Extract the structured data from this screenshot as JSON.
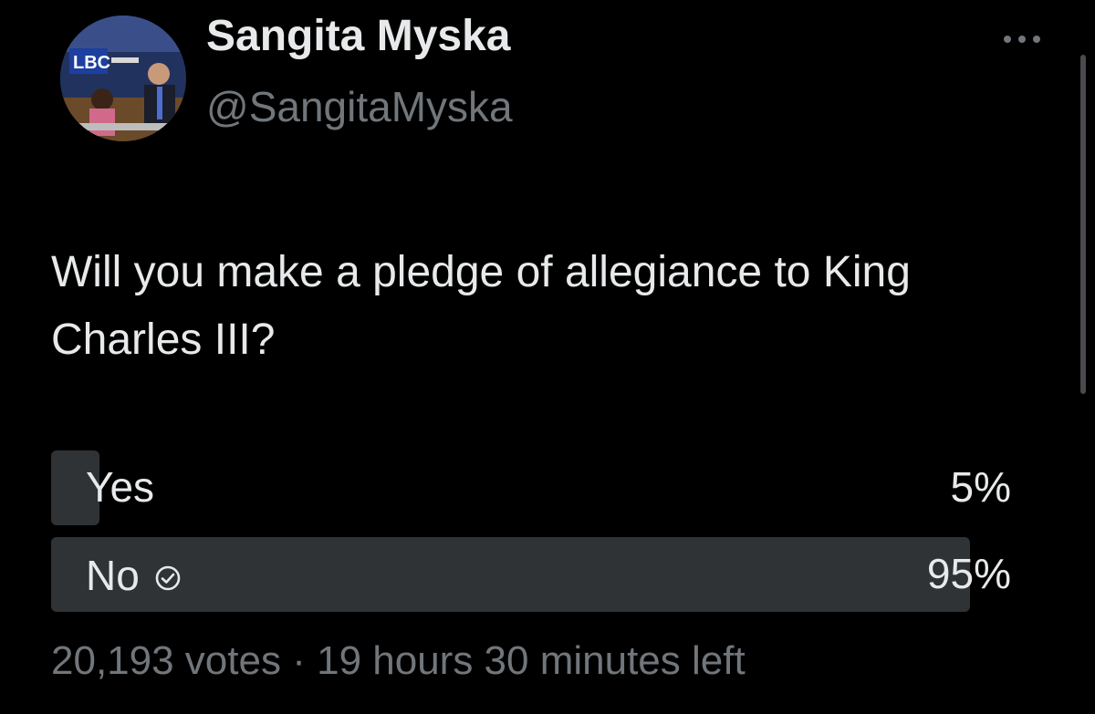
{
  "author": {
    "display_name": "Sangita Myska",
    "handle": "@SangitaMyska",
    "avatar_logo_text": "LBC"
  },
  "tweet": {
    "text": "Will you make a pledge of allegiance to King Charles III?"
  },
  "poll": {
    "options": [
      {
        "label": "Yes",
        "percent_text": "5%",
        "percent": 5,
        "selected": false
      },
      {
        "label": "No",
        "percent_text": "95%",
        "percent": 95,
        "selected": true
      }
    ],
    "votes": "20,193 votes",
    "separator": "·",
    "time_left": "19 hours 30 minutes left"
  },
  "icons": {
    "more": "more-horizontal-icon",
    "selected": "check-circle-icon"
  },
  "colors": {
    "background": "#000000",
    "primary_text": "#e7e9ea",
    "secondary_text": "#71767b",
    "poll_bar": "#2f3336"
  }
}
